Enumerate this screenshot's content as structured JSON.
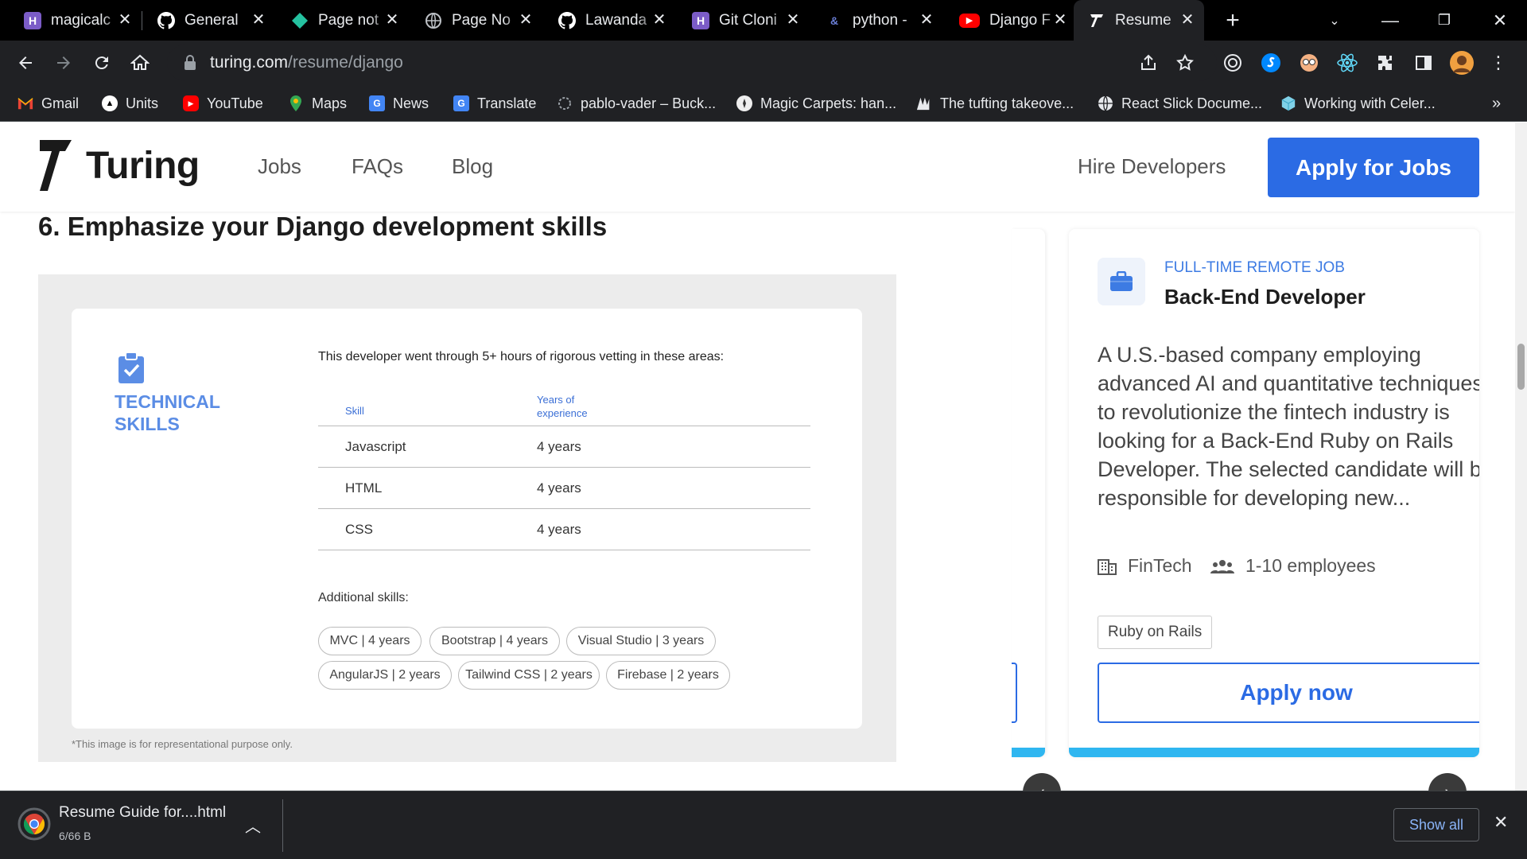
{
  "browser": {
    "tabs": [
      {
        "title": "magicalc",
        "icon": "heroku-icon",
        "color": "#7b5cc7",
        "glyph": "H"
      },
      {
        "title": "General",
        "icon": "github-icon",
        "color": "#000000",
        "glyph": ""
      },
      {
        "title": "Page not",
        "icon": "netlify-icon",
        "color": "#25c2a0",
        "glyph": ""
      },
      {
        "title": "Page No",
        "icon": "globe-icon",
        "color": "#5f6368",
        "glyph": ""
      },
      {
        "title": "Lawanda",
        "icon": "github-icon",
        "color": "#000000",
        "glyph": ""
      },
      {
        "title": "Git Cloni",
        "icon": "heroku-icon",
        "color": "#7b5cc7",
        "glyph": "H"
      },
      {
        "title": "python -",
        "icon": "python-docs-icon",
        "color": "#1f3a8a",
        "glyph": "&"
      },
      {
        "title": "Django F",
        "icon": "youtube-icon",
        "color": "#ff0000",
        "glyph": "▶"
      },
      {
        "title": "Resume",
        "icon": "turing-icon",
        "color": "#ffffff",
        "glyph": "7",
        "active": true
      }
    ],
    "url_host": "turing.com",
    "url_path": "/resume/django",
    "bookmarks": [
      {
        "label": "Gmail",
        "icon": "gmail-icon",
        "color": "#ea4335",
        "glyph": "M"
      },
      {
        "label": "Units",
        "icon": "units-icon",
        "color": "#000000",
        "glyph": "▲"
      },
      {
        "label": "YouTube",
        "icon": "youtube-icon",
        "color": "#ff0000",
        "glyph": "▶"
      },
      {
        "label": "Maps",
        "icon": "maps-icon",
        "color": "#34a853",
        "glyph": "●"
      },
      {
        "label": "News",
        "icon": "news-icon",
        "color": "#4285f4",
        "glyph": "G"
      },
      {
        "label": "Translate",
        "icon": "translate-icon",
        "color": "#4285f4",
        "glyph": "G"
      },
      {
        "label": "pablo-vader – Buck...",
        "icon": "bucket-icon",
        "color": "#5f6368",
        "glyph": "○"
      },
      {
        "label": "Magic Carpets: han...",
        "icon": "magic-carpets-icon",
        "color": "#eeeeee",
        "glyph": ""
      },
      {
        "label": "The tufting takeove...",
        "icon": "tufting-icon",
        "color": "#202124",
        "glyph": ""
      },
      {
        "label": "React Slick Docume...",
        "icon": "globe-icon",
        "color": "#e8eaed",
        "glyph": ""
      },
      {
        "label": "Working with Celer...",
        "icon": "cube-icon",
        "color": "#7fd1e8",
        "glyph": ""
      }
    ]
  },
  "site": {
    "logo_text": "Turing",
    "nav": [
      "Jobs",
      "FAQs",
      "Blog"
    ],
    "hire_link": "Hire Developers",
    "apply_button": "Apply for Jobs"
  },
  "article": {
    "heading": "6. Emphasize your Django development skills",
    "figure": {
      "section_title": "TECHNICAL SKILLS",
      "vetting_text": "This developer went through 5+ hours of rigorous vetting in these areas:",
      "col_skill": "Skill",
      "col_years": "Years of experience",
      "rows": [
        {
          "skill": "Javascript",
          "years": "4 years"
        },
        {
          "skill": "HTML",
          "years": "4 years"
        },
        {
          "skill": "CSS",
          "years": "4 years"
        }
      ],
      "additional_title": "Additional skills:",
      "chips": [
        "MVC | 4 years",
        "Bootstrap | 4 years",
        "Visual Studio | 3 years",
        "AngularJS | 2 years",
        "Tailwind CSS | 2 years",
        "Firebase | 2 years"
      ],
      "note": "*This image is for representational purpose only."
    }
  },
  "job": {
    "type": "FULL-TIME REMOTE JOB",
    "title": "Back-End Developer",
    "description": "A U.S.-based company employing advanced AI and quantitative techniques to revolutionize the fintech industry is looking for a Back-End Ruby on Rails Developer. The selected candidate will be responsible for developing new...",
    "industry": "FinTech",
    "company_size": "1-10 employees",
    "tag": "Ruby on Rails",
    "apply_label": "Apply now"
  },
  "downloads": {
    "file_name": "Resume Guide for....html",
    "progress_text": "6/66 B",
    "show_all": "Show all"
  },
  "colors": {
    "accent": "#2b6be4",
    "link_blue": "#3d7be3",
    "card_bar": "#2fb6f0"
  }
}
